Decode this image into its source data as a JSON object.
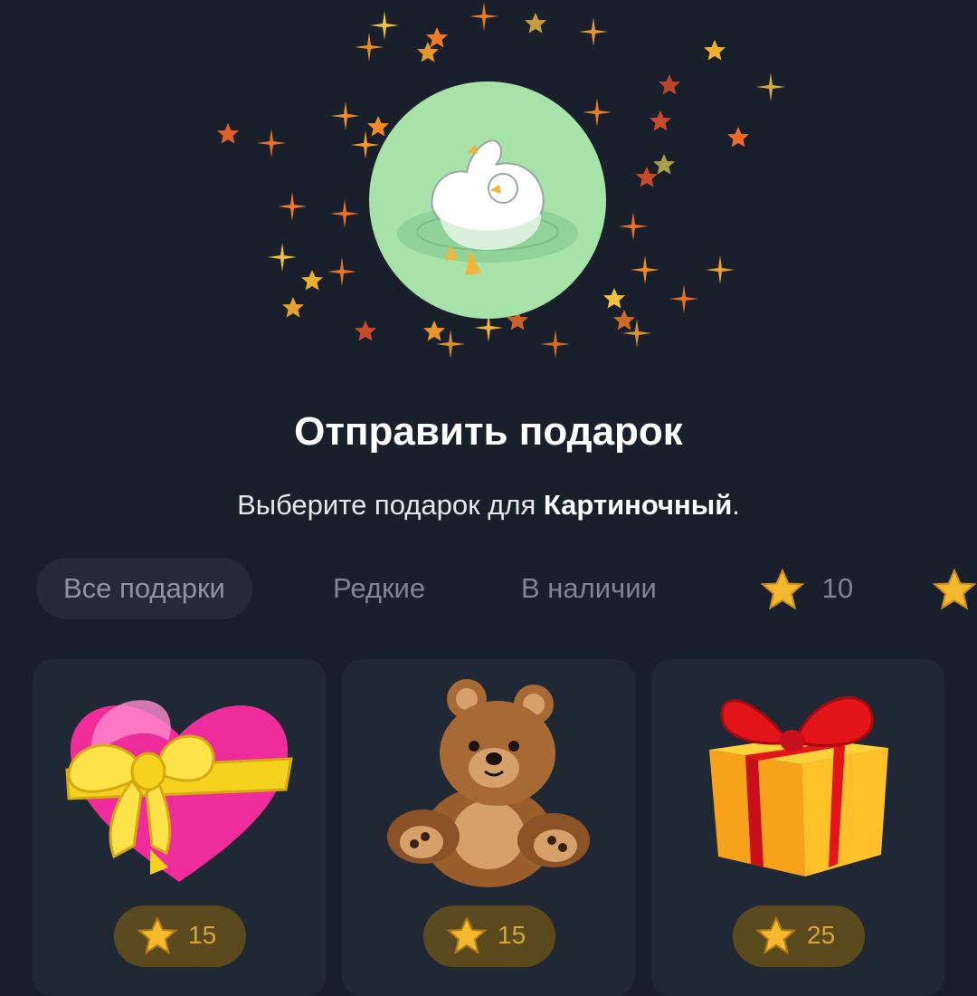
{
  "header": {
    "title": "Отправить подарок",
    "subtitle_prefix": "Выберите подарок для ",
    "recipient": "Картиночный",
    "subtitle_suffix": "."
  },
  "filters": [
    {
      "label": "Все подарки",
      "active": true
    },
    {
      "label": "Редкие",
      "active": false
    },
    {
      "label": "В наличии",
      "active": false
    },
    {
      "label": "10",
      "icon": "star-icon",
      "active": false
    }
  ],
  "gifts": [
    {
      "name": "heart-with-ribbon",
      "price": "15"
    },
    {
      "name": "teddy-bear",
      "price": "15"
    },
    {
      "name": "wrapped-gift-box",
      "price": "25"
    }
  ],
  "colors": {
    "background": "#1a202b",
    "card": "#212835",
    "avatar_bg": "#a7e2a8",
    "price_pill": "#5b4a1d",
    "price_text": "#d8a53a",
    "star": "#f5b82e"
  }
}
